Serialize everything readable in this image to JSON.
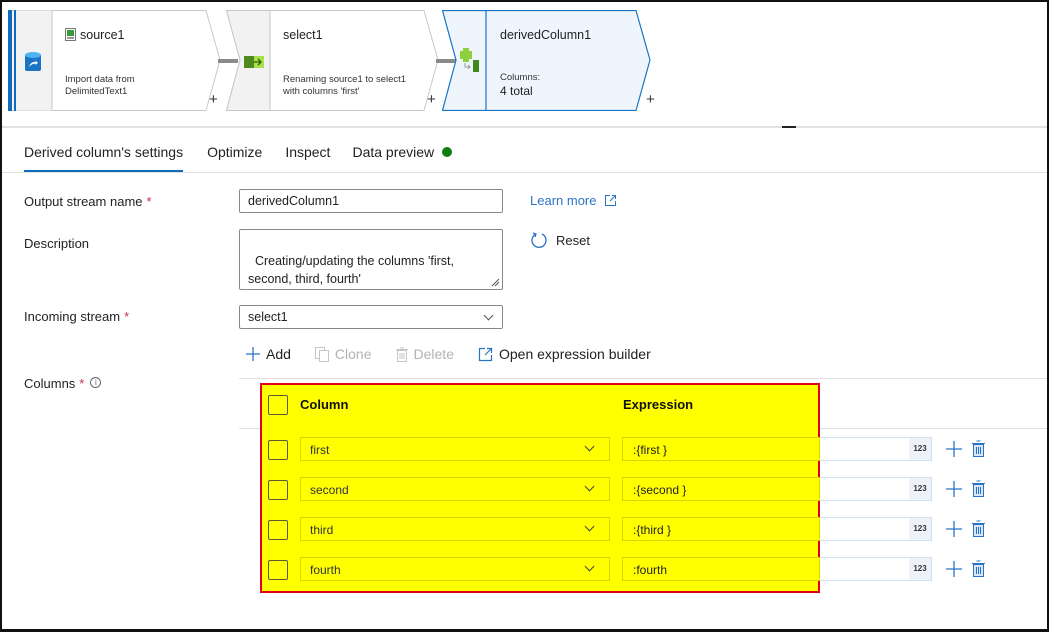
{
  "pipeline": {
    "nodes": [
      {
        "id": "source1",
        "title": "source1",
        "description_line1": "Import data from",
        "description_line2": "DelimitedText1",
        "icon": "database-icon",
        "title_icon": "csv-file-icon"
      },
      {
        "id": "select1",
        "title": "select1",
        "description_line1": "Renaming source1 to select1",
        "description_line2": "with columns 'first'",
        "icon": "select-transform-icon"
      },
      {
        "id": "derivedColumn1",
        "title": "derivedColumn1",
        "description_line1": "Columns:",
        "description_line2": "4 total",
        "icon": "derived-column-icon",
        "selected": true
      }
    ],
    "add_label": "+"
  },
  "tabs": [
    {
      "label": "Derived column's settings",
      "active": true
    },
    {
      "label": "Optimize"
    },
    {
      "label": "Inspect"
    },
    {
      "label": "Data preview",
      "status": "green-dot",
      "status_color": "#107c10"
    }
  ],
  "form": {
    "output_stream_label": "Output stream name",
    "output_stream_value": "derivedColumn1",
    "description_label": "Description",
    "description_value": "Creating/updating the columns 'first,\nsecond, third, fourth'",
    "incoming_stream_label": "Incoming stream",
    "incoming_stream_value": "select1",
    "columns_label": "Columns",
    "required_mark": "*",
    "info_glyph": "i",
    "learn_more": "Learn more",
    "reset": "Reset"
  },
  "toolbar": {
    "add": "Add",
    "clone": "Clone",
    "delete": "Delete",
    "open_expression_builder": "Open expression builder"
  },
  "table": {
    "headers": {
      "column": "Column",
      "expression": "Expression"
    },
    "rows": [
      {
        "column": "first",
        "expression": ":{first }",
        "type": "123"
      },
      {
        "column": "second",
        "expression": ":{second }",
        "type": "123"
      },
      {
        "column": "third",
        "expression": ":{third }",
        "type": "123"
      },
      {
        "column": "fourth",
        "expression": ":fourth",
        "type": "123"
      }
    ]
  },
  "colors": {
    "accent": "#0f6cbd",
    "highlight": "#ffff00",
    "highlight_border": "#e3001b",
    "link": "#2b73c6",
    "status_ok": "#107c10"
  }
}
